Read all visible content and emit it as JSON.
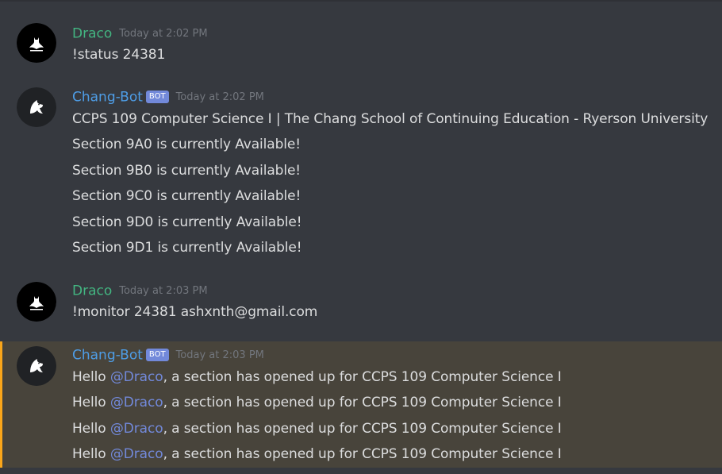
{
  "messages": [
    {
      "author": "Draco",
      "timestamp": "Today at 2:02 PM",
      "lines": [
        "!status 24381"
      ]
    },
    {
      "author": "Chang-Bot",
      "bot_tag": "BOT",
      "timestamp": "Today at 2:02 PM",
      "lines": [
        "CCPS 109 Computer Science I | The Chang School of Continuing Education - Ryerson University",
        "Section 9A0 is currently Available!",
        "Section 9B0 is currently Available!",
        "Section 9C0 is currently Available!",
        "Section 9D0 is currently Available!",
        "Section 9D1 is currently Available!"
      ]
    },
    {
      "author": "Draco",
      "timestamp": "Today at 2:03 PM",
      "lines": [
        "!monitor 24381 ashxnth@gmail.com"
      ]
    },
    {
      "author": "Chang-Bot",
      "bot_tag": "BOT",
      "timestamp": "Today at 2:03 PM",
      "mention_lines": [
        {
          "prefix": "Hello ",
          "mention": "@Draco",
          "suffix": ", a section has opened up for CCPS 109 Computer Science I"
        },
        {
          "prefix": "Hello ",
          "mention": "@Draco",
          "suffix": ", a section has opened up for CCPS 109 Computer Science I"
        },
        {
          "prefix": "Hello ",
          "mention": "@Draco",
          "suffix": ", a section has opened up for CCPS 109 Computer Science I"
        },
        {
          "prefix": "Hello ",
          "mention": "@Draco",
          "suffix": ", a section has opened up for CCPS 109 Computer Science I"
        }
      ]
    }
  ],
  "colors": {
    "background": "#36393f",
    "draco_name": "#43b581",
    "bot_name": "#4e9de6",
    "bot_tag": "#7289da",
    "mention_highlight_bg": "#48443b",
    "mention_highlight_border": "#faa61a",
    "timestamp": "#72767d",
    "message_text": "#dcddde"
  },
  "icons": {
    "draco_avatar": "batman-icon",
    "bot_avatar": "bot-wolf-icon"
  }
}
